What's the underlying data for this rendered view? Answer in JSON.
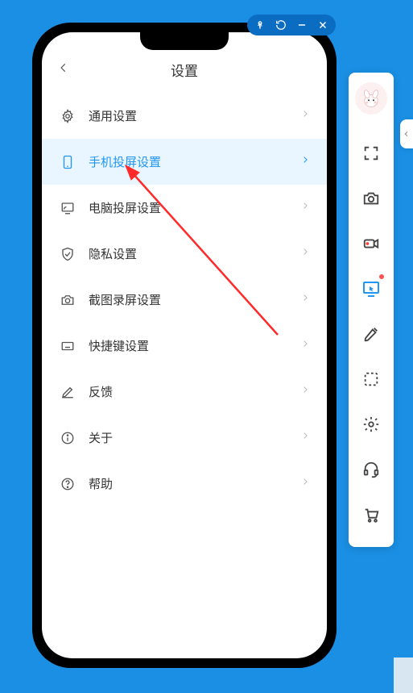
{
  "window_controls": {
    "pin": "pin",
    "restore": "restore",
    "minimize": "minimize",
    "close": "close"
  },
  "header": {
    "title": "设置"
  },
  "settings": [
    {
      "icon": "gear",
      "label": "通用设置",
      "selected": false
    },
    {
      "icon": "phone",
      "label": "手机投屏设置",
      "selected": true
    },
    {
      "icon": "monitor-cast",
      "label": "电脑投屏设置",
      "selected": false
    },
    {
      "icon": "shield",
      "label": "隐私设置",
      "selected": false
    },
    {
      "icon": "camera",
      "label": "截图录屏设置",
      "selected": false
    },
    {
      "icon": "keyboard",
      "label": "快捷键设置",
      "selected": false
    },
    {
      "icon": "pencil",
      "label": "反馈",
      "selected": false
    },
    {
      "icon": "info",
      "label": "关于",
      "selected": false
    },
    {
      "icon": "help",
      "label": "帮助",
      "selected": false
    }
  ],
  "sidebar": {
    "items": [
      {
        "name": "fullscreen",
        "active": false,
        "dot": false
      },
      {
        "name": "camera",
        "active": false,
        "dot": false
      },
      {
        "name": "record",
        "active": false,
        "dot": false
      },
      {
        "name": "cursor-screen",
        "active": true,
        "dot": true
      },
      {
        "name": "brush",
        "active": false,
        "dot": false
      },
      {
        "name": "select-region",
        "active": false,
        "dot": false
      },
      {
        "name": "settings-gear",
        "active": false,
        "dot": false
      },
      {
        "name": "support",
        "active": false,
        "dot": false
      },
      {
        "name": "cart",
        "active": false,
        "dot": false
      }
    ]
  }
}
